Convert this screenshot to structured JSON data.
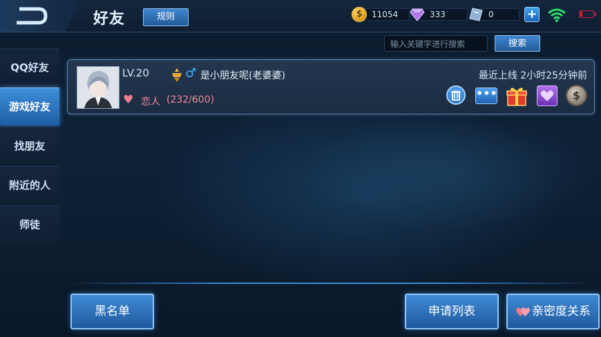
{
  "header": {
    "title": "好友",
    "rules_label": "规则"
  },
  "currency": {
    "coins": "11054",
    "gems": "333",
    "tickets": "0"
  },
  "sidebar": {
    "items": [
      {
        "label": "QQ好友"
      },
      {
        "label": "游戏好友"
      },
      {
        "label": "找朋友"
      },
      {
        "label": "附近的人"
      },
      {
        "label": "师徒"
      }
    ],
    "active_index": 1
  },
  "search": {
    "placeholder": "输入关键字进行搜索",
    "button_label": "搜索"
  },
  "friend": {
    "level": "LV.20",
    "nickname": "是小朋友呢(老婆婆)",
    "relation": "恋人",
    "intimacy": "(232/600)",
    "last_online": "最近上线  2小时25分钟前",
    "gender_icon": "♂"
  },
  "footer": {
    "blacklist_label": "黑名单",
    "requests_label": "申请列表",
    "intimacy_label": "亲密度关系"
  },
  "colors": {
    "accent": "#3e8ad3",
    "relation": "#f08b98",
    "background": "#0b1a2c"
  }
}
